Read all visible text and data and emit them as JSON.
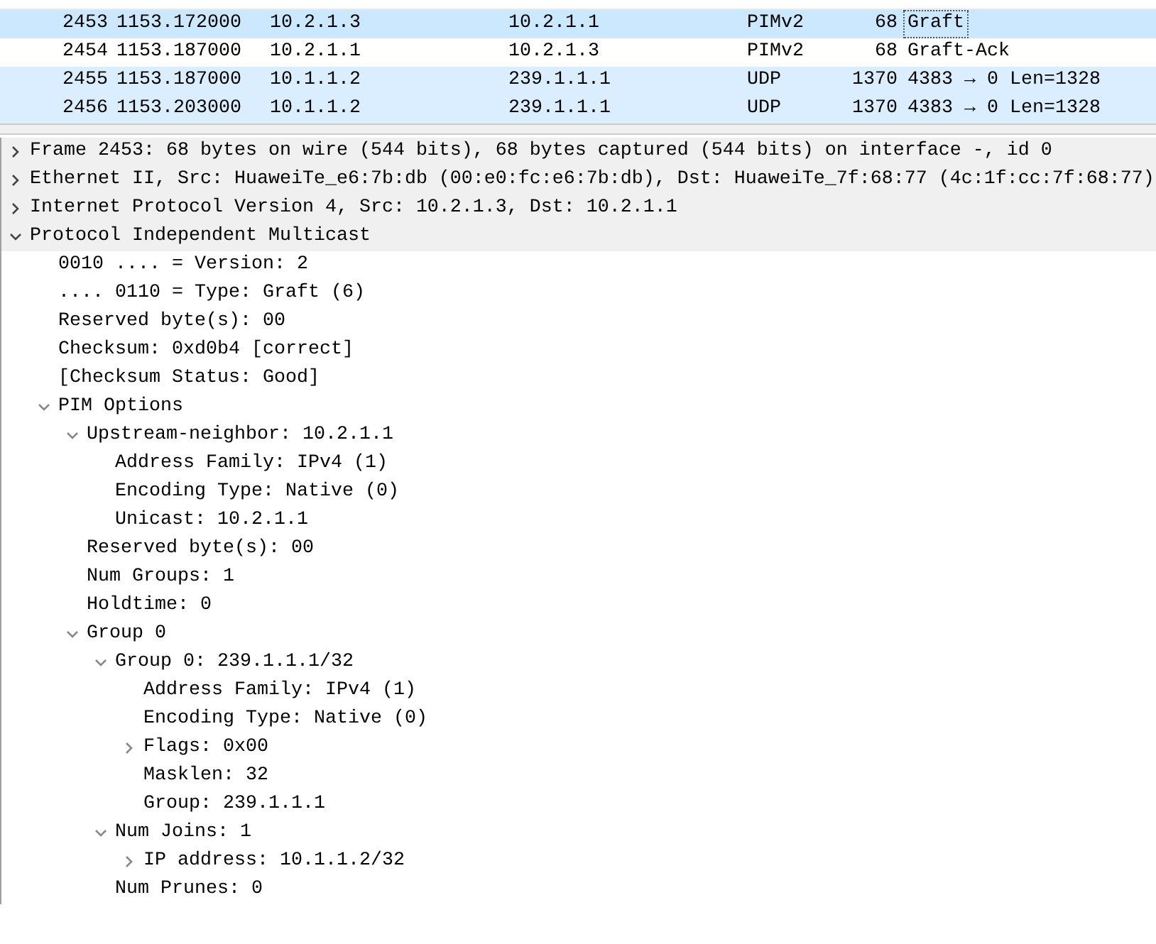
{
  "packet_list": {
    "rows": [
      {
        "no": "2453",
        "time": "1153.172000",
        "source": "10.2.1.3",
        "destination": "10.2.1.1",
        "protocol": "PIMv2",
        "length": "68",
        "info": "Graft",
        "selected": true,
        "kind": "pim"
      },
      {
        "no": "2454",
        "time": "1153.187000",
        "source": "10.2.1.1",
        "destination": "10.2.1.3",
        "protocol": "PIMv2",
        "length": "68",
        "info": "Graft-Ack",
        "selected": false,
        "kind": "pim"
      },
      {
        "no": "2455",
        "time": "1153.187000",
        "source": "10.1.1.2",
        "destination": "239.1.1.1",
        "protocol": "UDP",
        "length": "1370",
        "info": "4383 → 0 Len=1328",
        "selected": false,
        "kind": "udp"
      },
      {
        "no": "2456",
        "time": "1153.203000",
        "source": "10.1.1.2",
        "destination": "239.1.1.1",
        "protocol": "UDP",
        "length": "1370",
        "info": "4383 → 0 Len=1328",
        "selected": false,
        "kind": "udp"
      }
    ]
  },
  "packet_details": {
    "items": [
      {
        "label": "Frame 2453: 68 bytes on wire (544 bits), 68 bytes captured (544 bits) on interface -, id 0",
        "expanded": false
      },
      {
        "label": "Ethernet II, Src: HuaweiTe_e6:7b:db (00:e0:fc:e6:7b:db), Dst: HuaweiTe_7f:68:77 (4c:1f:cc:7f:68:77)",
        "expanded": false
      },
      {
        "label": "Internet Protocol Version 4, Src: 10.2.1.3, Dst: 10.2.1.1",
        "expanded": false
      },
      {
        "label": "Protocol Independent Multicast",
        "expanded": true,
        "children": [
          {
            "label": "0010 .... = Version: 2"
          },
          {
            "label": ".... 0110 = Type: Graft (6)"
          },
          {
            "label": "Reserved byte(s): 00"
          },
          {
            "label": "Checksum: 0xd0b4 [correct]"
          },
          {
            "label": "[Checksum Status: Good]"
          },
          {
            "label": "PIM Options",
            "expanded": true,
            "children": [
              {
                "label": "Upstream-neighbor: 10.2.1.1",
                "expanded": true,
                "children": [
                  {
                    "label": "Address Family: IPv4 (1)"
                  },
                  {
                    "label": "Encoding Type: Native (0)"
                  },
                  {
                    "label": "Unicast: 10.2.1.1"
                  }
                ]
              },
              {
                "label": "Reserved byte(s): 00"
              },
              {
                "label": "Num Groups: 1"
              },
              {
                "label": "Holdtime: 0"
              },
              {
                "label": "Group 0",
                "expanded": true,
                "children": [
                  {
                    "label": "Group 0: 239.1.1.1/32",
                    "expanded": true,
                    "children": [
                      {
                        "label": "Address Family: IPv4 (1)"
                      },
                      {
                        "label": "Encoding Type: Native (0)"
                      },
                      {
                        "label": "Flags: 0x00",
                        "expanded": false
                      },
                      {
                        "label": "Masklen: 32"
                      },
                      {
                        "label": "Group: 239.1.1.1"
                      }
                    ]
                  },
                  {
                    "label": "Num Joins: 1",
                    "expanded": true,
                    "children": [
                      {
                        "label": "IP address: 10.1.1.2/32",
                        "expanded": false
                      }
                    ]
                  },
                  {
                    "label": "Num Prunes: 0"
                  }
                ]
              }
            ]
          }
        ]
      }
    ]
  }
}
